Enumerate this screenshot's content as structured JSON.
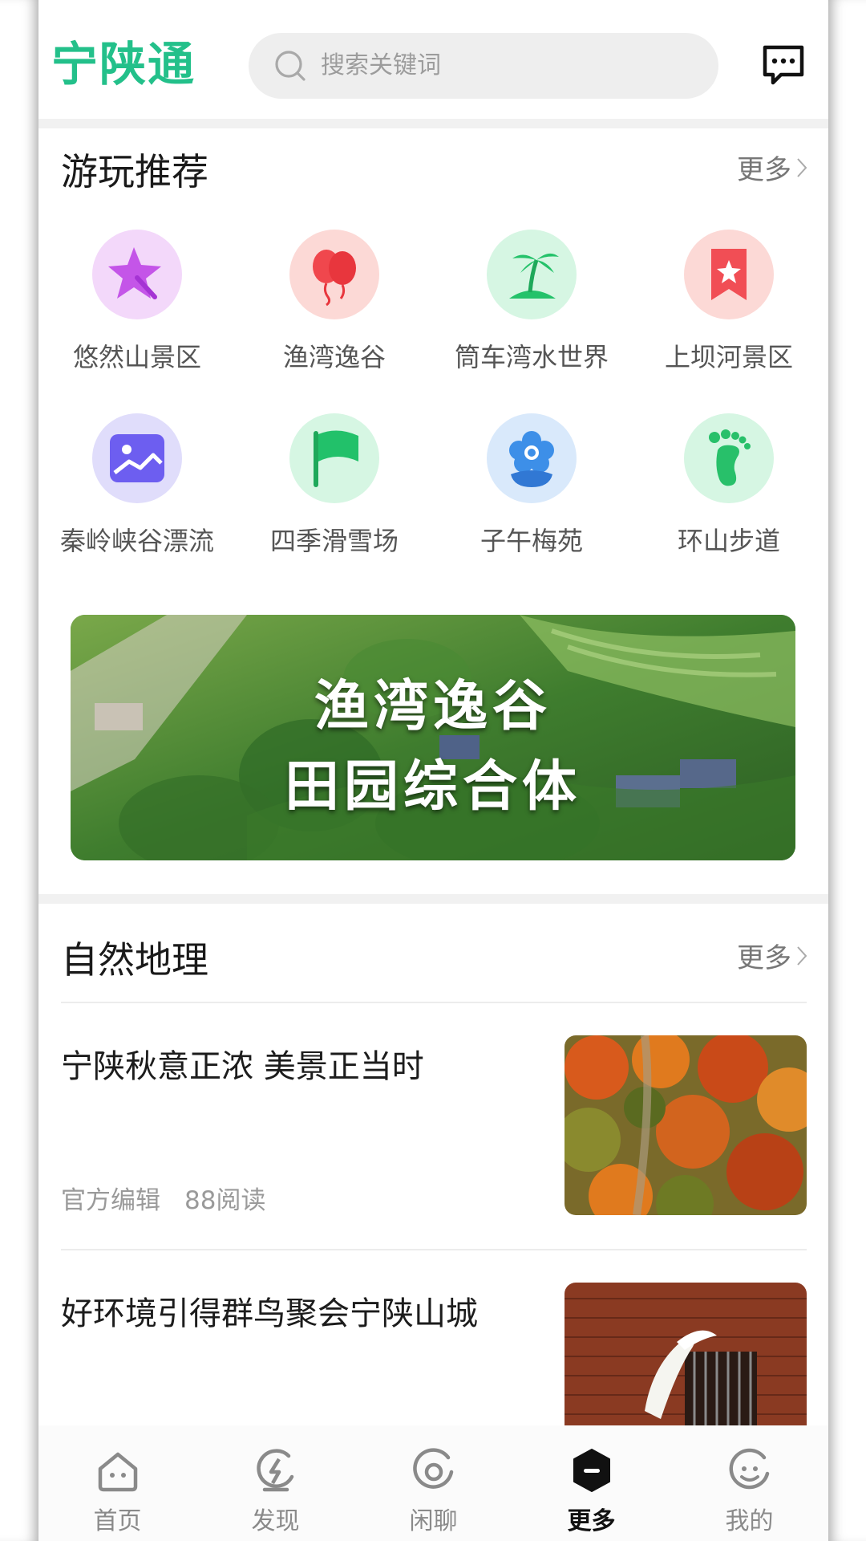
{
  "header": {
    "logo": "宁陕通",
    "search_placeholder": "搜索关键词"
  },
  "recommend": {
    "title": "游玩推荐",
    "more": "更多",
    "items": [
      {
        "label": "悠然山景区",
        "icon": "star-icon",
        "color": "#c455e8"
      },
      {
        "label": "渔湾逸谷",
        "icon": "balloon-icon",
        "color": "#f0474d"
      },
      {
        "label": "筒车湾水世界",
        "icon": "palm-island-icon",
        "color": "#24c26a"
      },
      {
        "label": "上坝河景区",
        "icon": "bookmark-star-icon",
        "color": "#f14e55"
      },
      {
        "label": "秦岭峡谷漂流",
        "icon": "picture-icon",
        "color": "#6d5ef0"
      },
      {
        "label": "四季滑雪场",
        "icon": "flag-icon",
        "color": "#22c16a"
      },
      {
        "label": "子午梅苑",
        "icon": "flower-icon",
        "color": "#3d8fe8"
      },
      {
        "label": "环山步道",
        "icon": "footprint-icon",
        "color": "#28c06a"
      }
    ]
  },
  "banner": {
    "line1": "渔湾逸谷",
    "line2": "田园综合体"
  },
  "nature": {
    "title": "自然地理",
    "more": "更多",
    "articles": [
      {
        "title": "宁陕秋意正浓 美景正当时",
        "author": "官方编辑",
        "reads": "88阅读"
      },
      {
        "title": "好环境引得群鸟聚会宁陕山城"
      }
    ]
  },
  "tabbar": {
    "tabs": [
      {
        "label": "首页",
        "icon": "home-icon"
      },
      {
        "label": "发现",
        "icon": "discover-icon"
      },
      {
        "label": "闲聊",
        "icon": "chat-icon"
      },
      {
        "label": "更多",
        "icon": "more-icon",
        "active": true
      },
      {
        "label": "我的",
        "icon": "profile-icon"
      }
    ]
  },
  "colors": {
    "brand": "#23c08a",
    "active_tab": "#111111"
  }
}
